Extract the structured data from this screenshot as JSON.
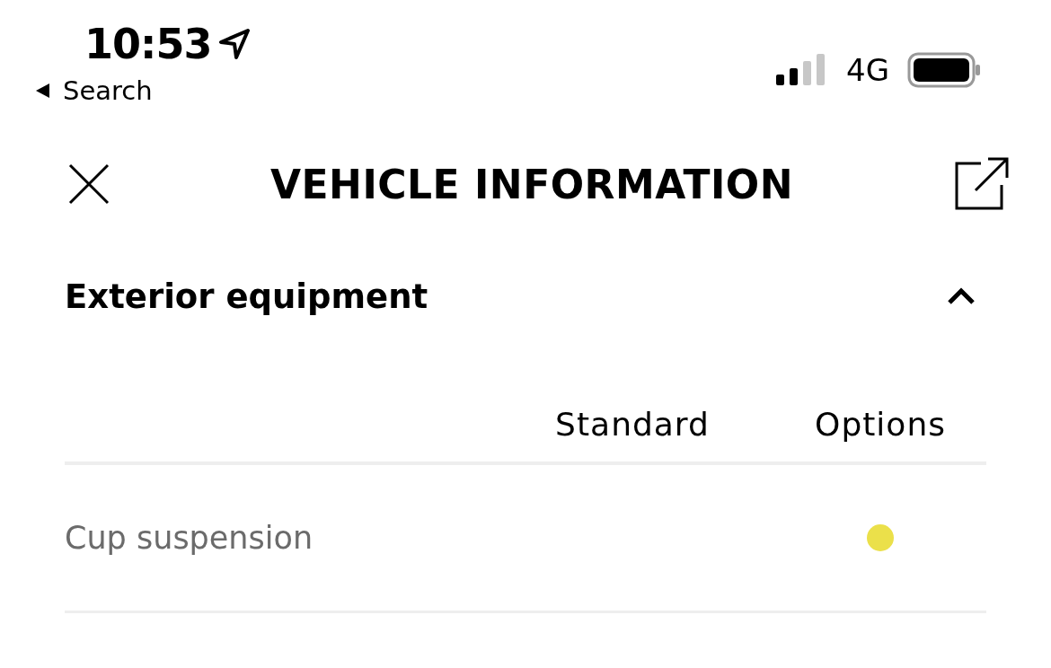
{
  "status_bar": {
    "time": "10:53",
    "back_label": "Search",
    "network": "4G"
  },
  "header": {
    "title": "VEHICLE INFORMATION"
  },
  "section": {
    "title": "Exterior equipment",
    "expanded": true
  },
  "table": {
    "columns": [
      "Standard",
      "Options"
    ],
    "rows": [
      {
        "label": "Cup suspension",
        "standard": false,
        "options": true
      }
    ]
  }
}
